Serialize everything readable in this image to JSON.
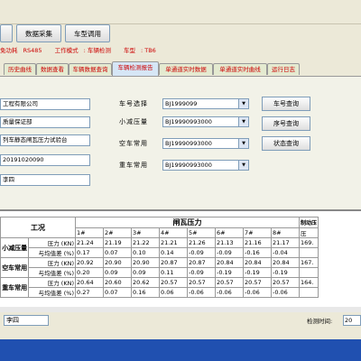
{
  "toolbar": {
    "buttons": [
      {
        "label": ""
      },
      {
        "label": "数据采集"
      },
      {
        "label": "车型调用"
      }
    ]
  },
  "status": {
    "protocol": "RS485",
    "mode_label": "工作模式",
    "mode": "车辆检测",
    "type_label": "车型",
    "type": "TB6",
    "prefix": "免功耗"
  },
  "tabs": [
    {
      "label": "历史曲线"
    },
    {
      "label": "数据查看"
    },
    {
      "label": "车辆数据查询"
    },
    {
      "label": "车辆检测报告"
    },
    {
      "label": "单通道实时数据"
    },
    {
      "label": "单通道实时曲线"
    },
    {
      "label": "运行日志"
    }
  ],
  "info_fields": [
    {
      "value": "工程有限公司"
    },
    {
      "value": "质量保证部"
    },
    {
      "value": "列车静态闸瓦压力试验台"
    },
    {
      "value": "20191020090"
    },
    {
      "value": "李四"
    }
  ],
  "selectors": [
    {
      "label": "车号选择",
      "value": "BJ1999099"
    },
    {
      "label": "小减压量",
      "value": "BJ19990993000"
    },
    {
      "label": "空车常用",
      "value": "BJ19990993000"
    },
    {
      "label": "重车常用",
      "value": "BJ19990993000"
    }
  ],
  "query_buttons": [
    {
      "label": "车号查询"
    },
    {
      "label": "序号查询"
    },
    {
      "label": "状态查询"
    }
  ],
  "table": {
    "condition_header": "工况",
    "pressure_header": "闸瓦压力",
    "extra_header": "制动压",
    "extra_sub": "压",
    "columns": [
      "1#",
      "2#",
      "3#",
      "4#",
      "5#",
      "6#",
      "7#",
      "8#"
    ],
    "groups": [
      {
        "name": "小减压量",
        "rows": [
          {
            "label": "压力 (KN)",
            "values": [
              "21.24",
              "21.19",
              "21.22",
              "21.21",
              "21.26",
              "21.13",
              "21.16",
              "21.17"
            ],
            "extra": "169."
          },
          {
            "label": "与均值差 (%)",
            "values": [
              "0.17",
              "0.07",
              "0.10",
              "0.14",
              "-0.09",
              "-0.09",
              "-0.16",
              "-0.04"
            ],
            "extra": ""
          }
        ]
      },
      {
        "name": "空车常用",
        "rows": [
          {
            "label": "压力 (KN)",
            "values": [
              "20.92",
              "20.90",
              "20.90",
              "20.87",
              "20.87",
              "20.84",
              "20.84",
              "20.84"
            ],
            "extra": "167."
          },
          {
            "label": "与均值差 (%)",
            "values": [
              "0.20",
              "0.09",
              "0.09",
              "0.11",
              "-0.09",
              "-0.19",
              "-0.19",
              "-0.19"
            ],
            "extra": ""
          }
        ]
      },
      {
        "name": "重车常用",
        "rows": [
          {
            "label": "压力 (KN)",
            "values": [
              "20.64",
              "20.60",
              "20.62",
              "20.57",
              "20.57",
              "20.57",
              "20.57",
              "20.57"
            ],
            "extra": "164."
          },
          {
            "label": "与均值差 (%)",
            "values": [
              "0.27",
              "0.07",
              "0.16",
              "0.06",
              "-0.06",
              "-0.06",
              "-0.06",
              "-0.06"
            ],
            "extra": ""
          }
        ]
      }
    ]
  },
  "footer": {
    "inspector": "李四",
    "time_label": "检测时间:",
    "time_value": "20"
  },
  "colors": {
    "accent": "#c00000",
    "panel": "#f2f2e8",
    "window": "#ece9d8"
  }
}
